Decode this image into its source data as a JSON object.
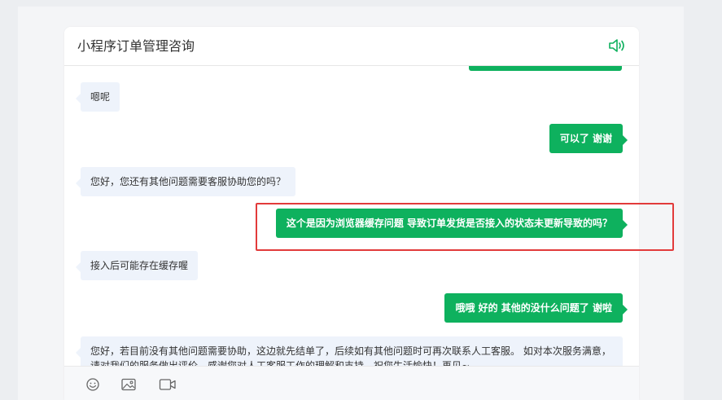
{
  "header": {
    "title": "小程序订单管理咨询",
    "speaker_icon": "speaker-icon"
  },
  "messages": [
    {
      "side": "left",
      "text": "嗯呢"
    },
    {
      "side": "right",
      "text": "可以了 谢谢"
    },
    {
      "side": "left",
      "text": "您好，您还有其他问题需要客服协助您的吗？"
    },
    {
      "side": "right",
      "text": "这个是因为浏览器缓存问题 导致订单发货是否接入的状态未更新导致的吗？"
    },
    {
      "side": "left",
      "text": "接入后可能存在缓存喔"
    },
    {
      "side": "right",
      "text": "哦哦 好的 其他的没什么问题了 谢啦"
    },
    {
      "side": "left",
      "text": "您好，若目前没有其他问题需要协助，这边就先结单了，后续如有其他问题时可再次联系人工客服。 如对本次服务满意，请对我们的服务做出评价，感谢您对人工客服工作的理解和支持，祝您生活愉快！再见~"
    }
  ],
  "toolbar": {
    "icons": [
      "emoji-icon",
      "image-icon",
      "video-icon"
    ]
  },
  "colors": {
    "accent_green": "#0eb15e",
    "incoming_bubble": "#eef3fb",
    "highlight_red": "#e23b3b"
  }
}
